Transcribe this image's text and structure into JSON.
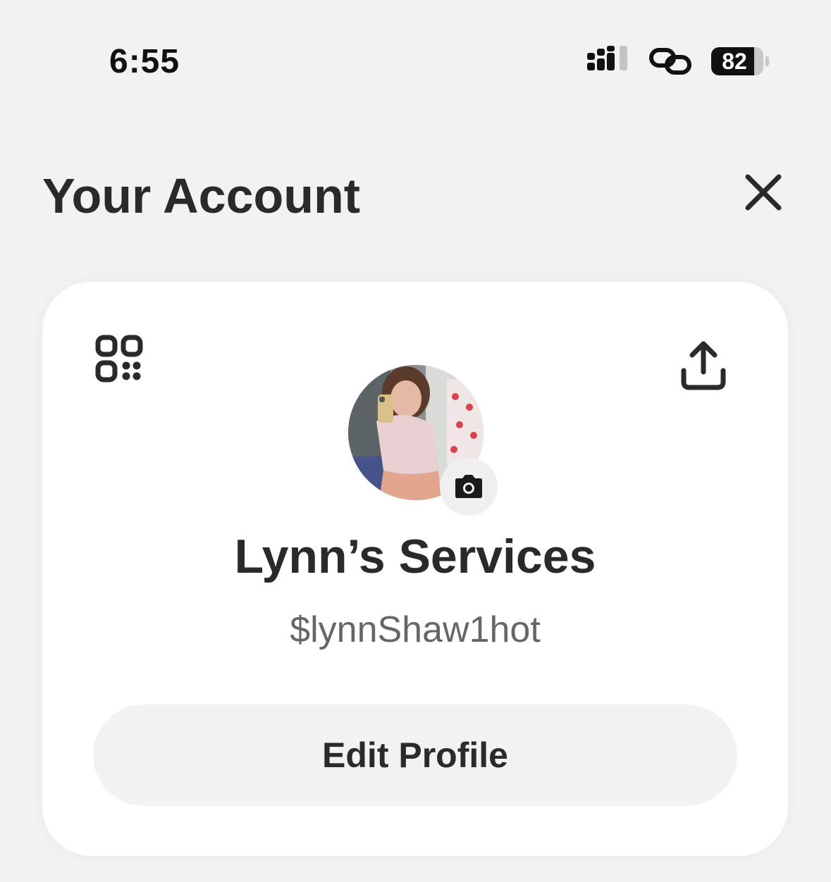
{
  "status_bar": {
    "time": "6:55",
    "battery_level": "82",
    "battery_fraction": 0.82,
    "icons": [
      "cellular-signal-icon",
      "personal-hotspot-icon",
      "battery-icon"
    ]
  },
  "header": {
    "title": "Your Account",
    "close_icon": "close-icon"
  },
  "profile": {
    "name": "Lynn’s Services",
    "cashtag": "$lynnShaw1hot",
    "edit_button_label": "Edit Profile",
    "qr_icon": "qr-code-icon",
    "share_icon": "share-icon",
    "camera_icon": "camera-icon"
  },
  "colors": {
    "background": "#f2f2f2",
    "card": "#ffffff",
    "text_primary": "#2a2a2a",
    "text_secondary": "#666666",
    "button_bg": "#f2f2f2"
  }
}
